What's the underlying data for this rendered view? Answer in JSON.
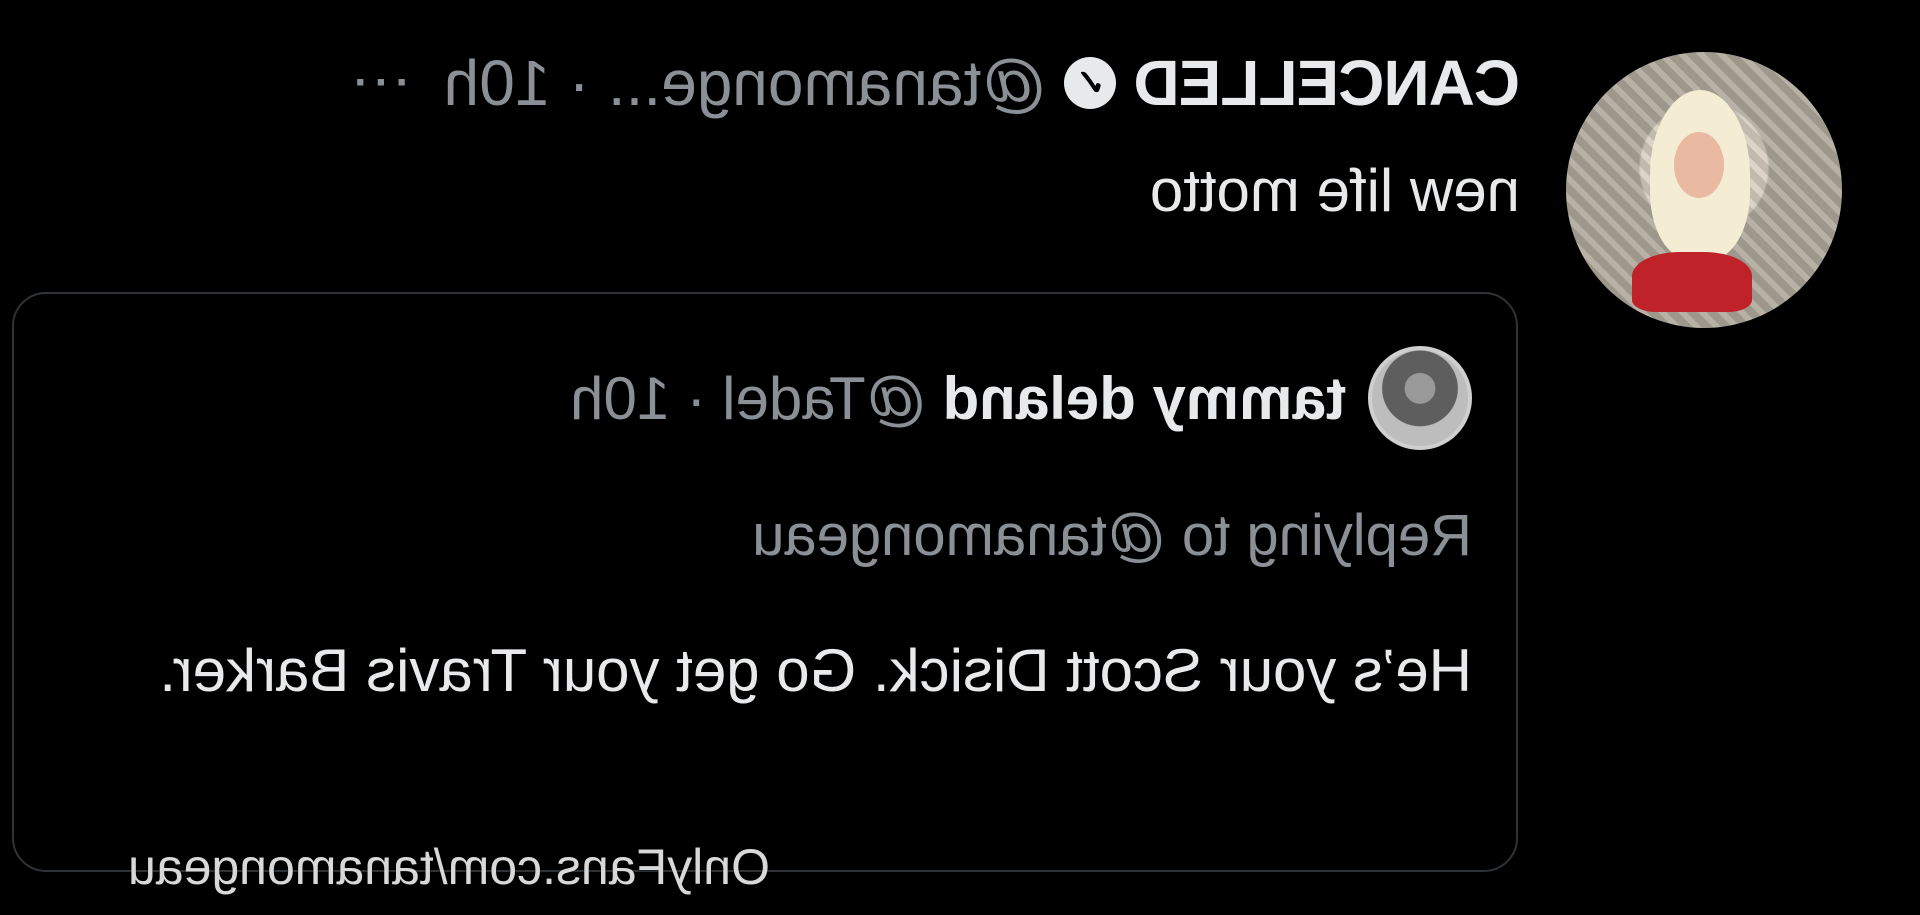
{
  "tweet": {
    "display_name": "CANCELLED",
    "verified_icon": "verified-badge-icon",
    "handle": "@tanamonge...",
    "separator": "·",
    "time": "10h",
    "more": "···",
    "text": "new life motto"
  },
  "quoted_tweet": {
    "display_name": "tammy deland",
    "handle": "@Tadel",
    "separator": "·",
    "time": "10h",
    "replying_to": "Replying to @tanamongeau",
    "text": "He’s your Scott Disick. Go get your Travis Barker."
  },
  "watermark": "OnlyFans.com/tanamongeau",
  "colors": {
    "background": "#000000",
    "primary_text": "#e7e9ea",
    "secondary_text": "#8b9096",
    "card_border": "#2f3336",
    "avatar_accent": "#c0222a"
  }
}
